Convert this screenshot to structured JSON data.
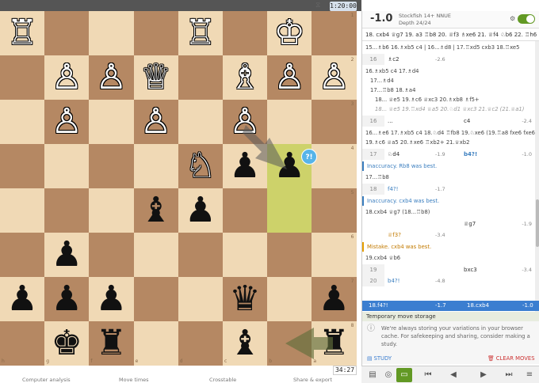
{
  "topbar": {
    "left_text": "",
    "clock": "1:20:00"
  },
  "board": {
    "ranks": [
      "1",
      "2",
      "3",
      "4",
      "5",
      "6",
      "7",
      "8"
    ],
    "files": [
      "h",
      "g",
      "f",
      "e",
      "d",
      "c",
      "b",
      "a"
    ],
    "annotation_badge": "?!",
    "pieces": [
      {
        "glyph": "♖",
        "side": "w",
        "col": 0,
        "row": 0,
        "name": "white-rook"
      },
      {
        "glyph": "♖",
        "side": "w",
        "col": 4,
        "row": 0,
        "name": "white-rook"
      },
      {
        "glyph": "♔",
        "side": "w",
        "col": 6,
        "row": 0,
        "name": "white-king"
      },
      {
        "glyph": "♙",
        "side": "w",
        "col": 1,
        "row": 1,
        "name": "white-pawn"
      },
      {
        "glyph": "♙",
        "side": "w",
        "col": 2,
        "row": 1,
        "name": "white-pawn"
      },
      {
        "glyph": "♕",
        "side": "w",
        "col": 3,
        "row": 1,
        "name": "white-queen"
      },
      {
        "glyph": "♗",
        "side": "w",
        "col": 5,
        "row": 1,
        "name": "white-bishop"
      },
      {
        "glyph": "♙",
        "side": "w",
        "col": 6,
        "row": 1,
        "name": "white-pawn"
      },
      {
        "glyph": "♙",
        "side": "w",
        "col": 7,
        "row": 1,
        "name": "white-pawn"
      },
      {
        "glyph": "♙",
        "side": "w",
        "col": 1,
        "row": 2,
        "name": "white-pawn"
      },
      {
        "glyph": "♙",
        "side": "w",
        "col": 3,
        "row": 2,
        "name": "white-pawn"
      },
      {
        "glyph": "♙",
        "side": "w",
        "col": 5,
        "row": 2,
        "name": "white-pawn"
      },
      {
        "glyph": "♘",
        "side": "w",
        "col": 4,
        "row": 3,
        "name": "white-knight"
      },
      {
        "glyph": "♟",
        "side": "b",
        "col": 5,
        "row": 3,
        "name": "black-pawn"
      },
      {
        "glyph": "♟",
        "side": "b",
        "col": 6,
        "row": 3,
        "name": "black-pawn"
      },
      {
        "glyph": "♝",
        "side": "b",
        "col": 3,
        "row": 4,
        "name": "black-bishop"
      },
      {
        "glyph": "♟",
        "side": "b",
        "col": 4,
        "row": 4,
        "name": "black-pawn"
      },
      {
        "glyph": "♟",
        "side": "b",
        "col": 1,
        "row": 5,
        "name": "black-pawn"
      },
      {
        "glyph": "♟",
        "side": "b",
        "col": 0,
        "row": 6,
        "name": "black-pawn"
      },
      {
        "glyph": "♟",
        "side": "b",
        "col": 1,
        "row": 6,
        "name": "black-pawn"
      },
      {
        "glyph": "♟",
        "side": "b",
        "col": 2,
        "row": 6,
        "name": "black-pawn"
      },
      {
        "glyph": "♛",
        "side": "b",
        "col": 5,
        "row": 6,
        "name": "black-queen"
      },
      {
        "glyph": "♟",
        "side": "b",
        "col": 7,
        "row": 6,
        "name": "black-pawn"
      },
      {
        "glyph": "♚",
        "side": "b",
        "col": 1,
        "row": 7,
        "name": "black-king"
      },
      {
        "glyph": "♜",
        "side": "b",
        "col": 2,
        "row": 7,
        "name": "black-rook"
      },
      {
        "glyph": "♝",
        "side": "b",
        "col": 5,
        "row": 7,
        "name": "black-bishop"
      },
      {
        "glyph": "♜",
        "side": "b",
        "col": 7,
        "row": 7,
        "name": "black-rook"
      }
    ]
  },
  "below_board": {
    "computer_analysis": "Computer analysis",
    "move_times": "Move times",
    "crosstable": "Crosstable",
    "share_export": "Share & export",
    "clock": "34:27"
  },
  "engine": {
    "eval": "-1.0",
    "name": "Stockfish 14+ NNUE",
    "depth": "Depth 24/24",
    "pv": "18. cxb4 ♕g7 19. a3 ♖b8 20. ♕f3 ♗xe6 21. ♕f4 ♘b6 22. ♖h6 ♗5..."
  },
  "moves": {
    "v15": "15...♗b6 16.♗xb5 c4 | 16...♗d8 | 17.♖xd5 cxb3 18.♖xe5",
    "r16_num": "16",
    "r16_m1": "♗c2",
    "r16_e1": "-2.6",
    "v16a": "16.♗xb5 c4 17.♗d4",
    "v16b": "17...♗d4",
    "v16c": "17...♖b8 18.♗a4",
    "v16d": "18... ♕e5 19.♗c6 ♕xc3 20.♗xb8 ♗f5+",
    "v16e": "18... ♕e5 19.♖xd4 ♕a5 20.♘d1 ♕xc3 21.♕c2 (21.♕a1)",
    "r16b_num": "16",
    "r16b_m1": "...",
    "r16b_m2": "c4",
    "r16b_e2": "-2.4",
    "v16f": "16...♗e6 17.♗xb5 c4 18.♘d4 ♖fb8 19.♘xe6 (19.♖a8 fxe6 fxe6)",
    "v16g": "19.♗c6 ♕a5 20.♗xe6 ♖xb2+ 21.♕xb2",
    "r17_num": "17",
    "r17_m1": "♘d4",
    "r17_e1": "-1.9",
    "r17_m2": "b4?!",
    "r17_e2": "-1.0",
    "c17": "Inaccuracy. Rb8 was best.",
    "v17": "17...♖b8",
    "r18_num": "18",
    "r18_m1": "f4?!",
    "r18_e1": "-1.7",
    "c18": "Inaccuracy. cxb4 was best.",
    "v18": "18.cxb4 ♕g7 (18...♖b8)",
    "r18b_m2": "♕g7",
    "r18b_e2": "-1.9",
    "r18c_m1": "♕f3?",
    "r18c_e1": "-3.4",
    "c19": "Mistake. cxb4 was best.",
    "v19": "19.cxb4 ♕b6",
    "r19_num": "19",
    "r19_m2": "bxc3",
    "r19_e2": "-3.4",
    "r20_num": "20",
    "r20_m1": "b4?!",
    "r20_e1": "-4.8"
  },
  "current": {
    "left": "18.f4?!",
    "left_eval": "-1.7",
    "right": "18.cxb4",
    "right_eval": "-1.0"
  },
  "storage": {
    "title": "Temporary move storage",
    "text": "We're always storing your variations in your browser cache. For safekeeping and sharing, consider making a study.",
    "study": "STUDY",
    "clear": "CLEAR MOVES"
  },
  "colors": {
    "light": "#f0d9b5",
    "dark": "#b58863",
    "highlight": "#cdd26a",
    "accent": "#629924",
    "blue": "#3b7ed0"
  }
}
